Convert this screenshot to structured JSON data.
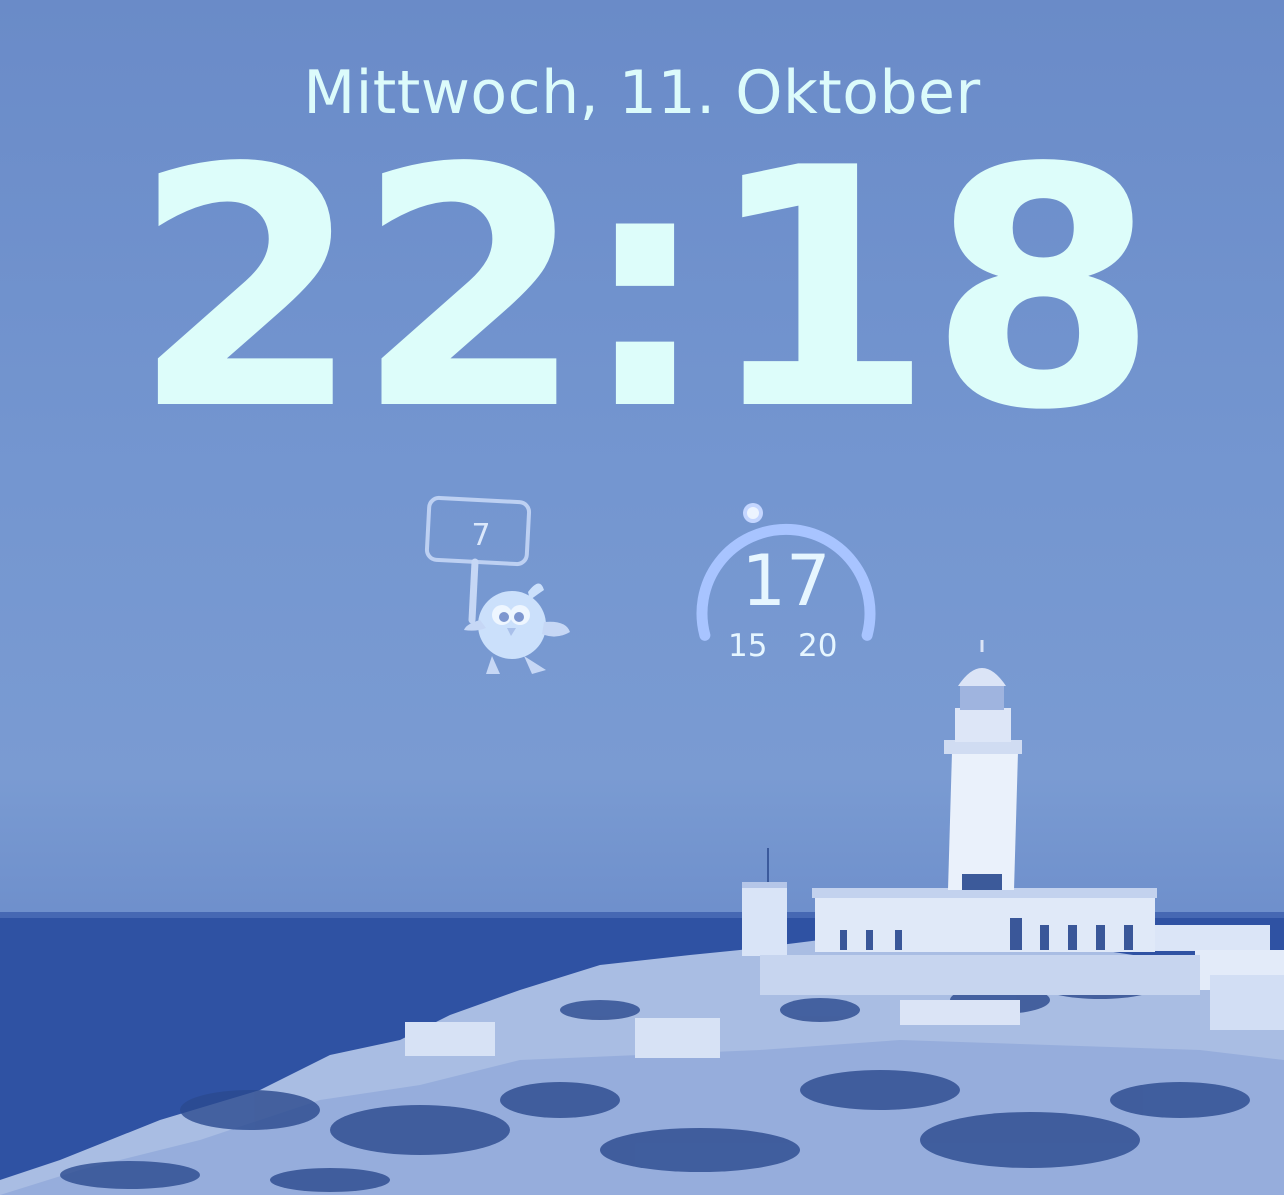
{
  "lockscreen": {
    "date": "Mittwoch, 11. Oktober",
    "time": "22:18"
  },
  "widgets": {
    "duolingo": {
      "streak": "7",
      "icon": "duolingo-mascot-icon"
    },
    "weather": {
      "current": "17",
      "low": "15",
      "high": "20",
      "gauge_color": "#a8c4ff"
    }
  },
  "wallpaper": {
    "subject": "lighthouse-on-cliff-image",
    "tint": "#6f8fcb"
  }
}
